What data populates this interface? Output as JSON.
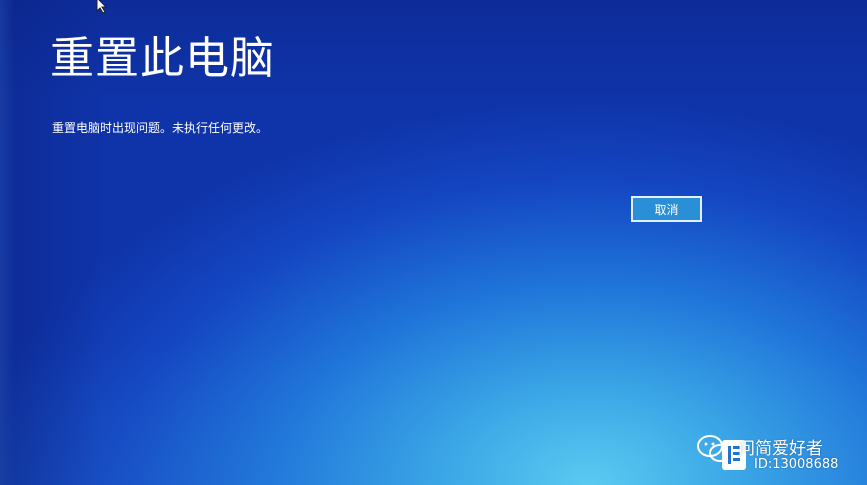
{
  "screen": {
    "title": "重置此电脑",
    "message": "重置电脑时出现问题。未执行任何更改。",
    "cancel_label": "取消"
  },
  "watermark": {
    "name": "问简爱好者",
    "id": "ID:13008688"
  },
  "icons": {
    "cursor": "mouse-pointer-icon",
    "wechat": "wechat-icon",
    "logo": "account-logo-icon"
  },
  "colors": {
    "background_top": "#0f33a8",
    "background_glow": "#5fd0f2",
    "button_fill": "#2a8fd6",
    "button_border": "#dff2ff",
    "text": "#ffffff"
  }
}
